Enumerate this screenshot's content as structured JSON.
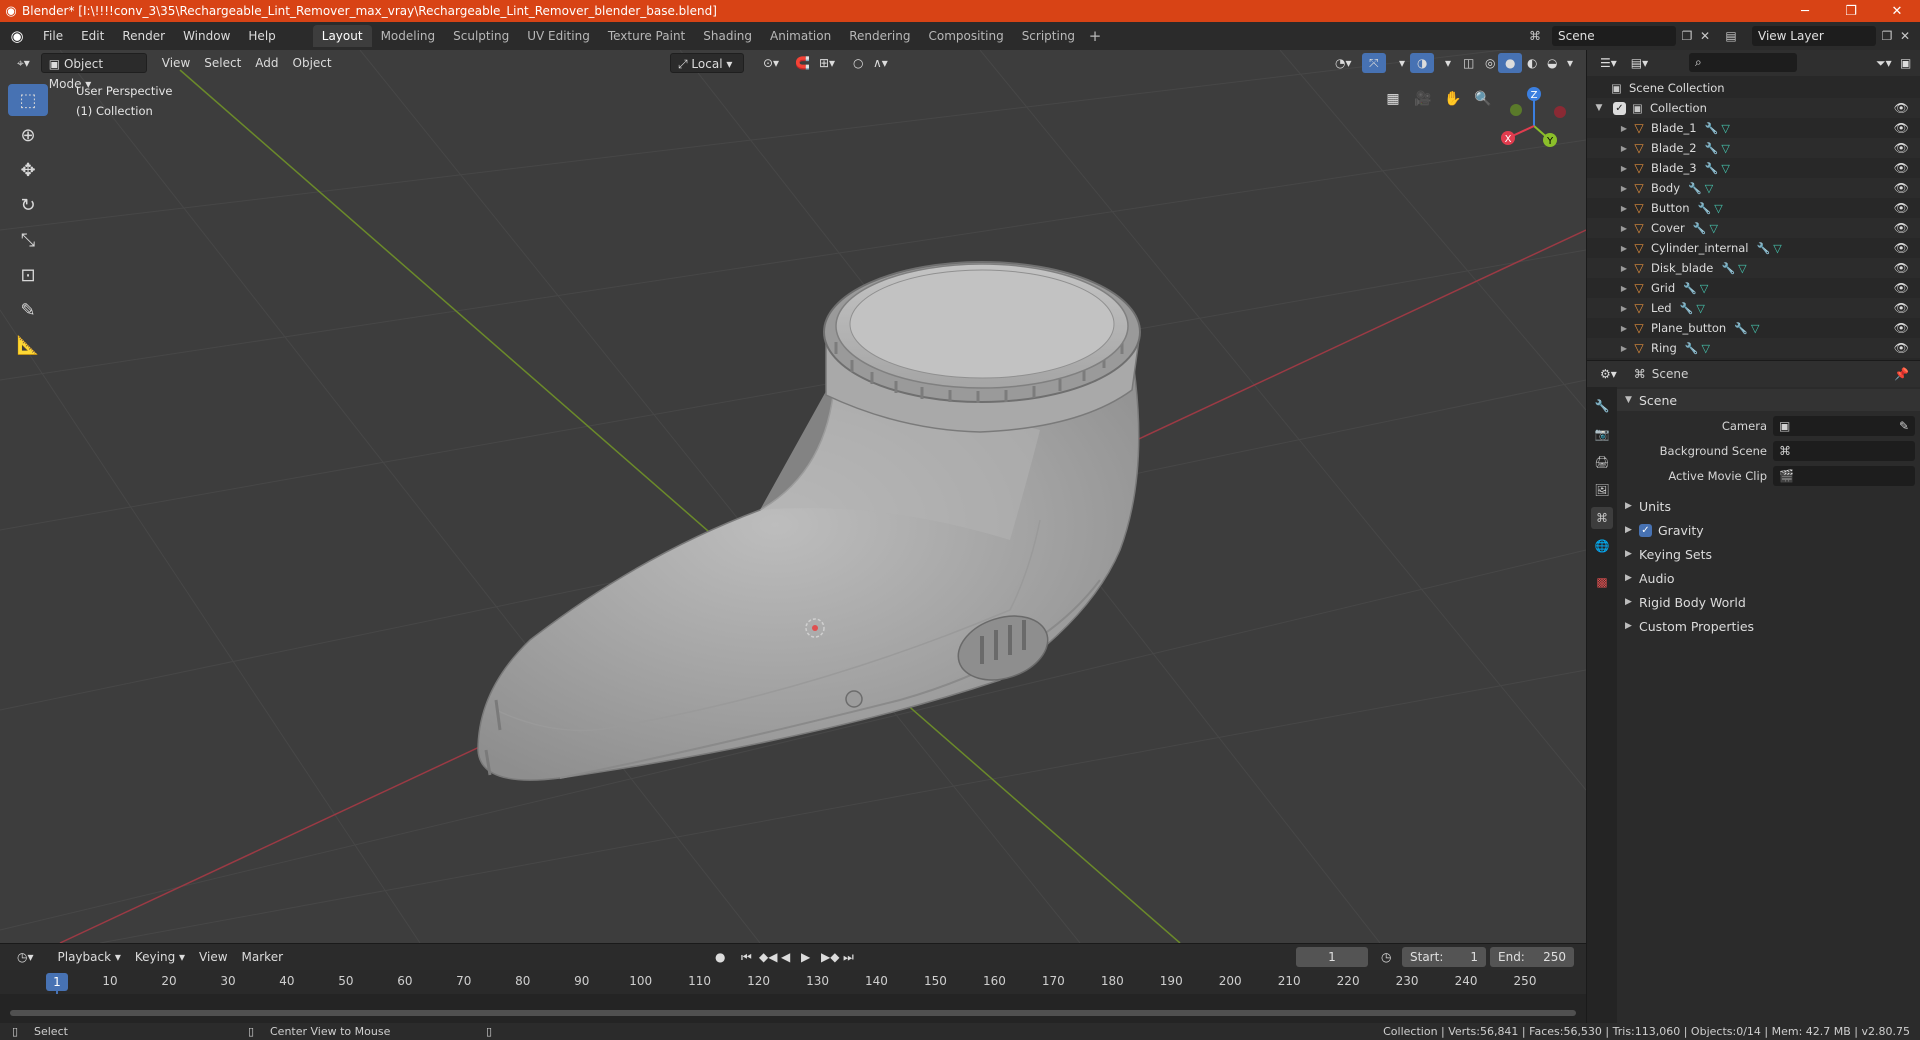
{
  "window": {
    "title": "Blender* [I:\\!!!!conv_3\\35\\Rechargeable_Lint_Remover_max_vray\\Rechargeable_Lint_Remover_blender_base.blend]",
    "minimize": "─",
    "maximize": "❐",
    "close": "✕"
  },
  "menu": [
    "File",
    "Edit",
    "Render",
    "Window",
    "Help"
  ],
  "workspaces": [
    "Layout",
    "Modeling",
    "Sculpting",
    "UV Editing",
    "Texture Paint",
    "Shading",
    "Animation",
    "Rendering",
    "Compositing",
    "Scripting"
  ],
  "active_workspace": "Layout",
  "scene_name": "Scene",
  "view_layer": "View Layer",
  "viewport": {
    "mode": "Object Mode",
    "menus": [
      "View",
      "Select",
      "Add",
      "Object"
    ],
    "transform_orientation": "Local",
    "perspective": "User Perspective",
    "collection": "(1) Collection",
    "gizmo_axes": {
      "x": "X",
      "y": "Y",
      "z": "Z"
    }
  },
  "tools": [
    "select-box",
    "cursor",
    "move",
    "rotate",
    "scale",
    "transform",
    "annotate",
    "measure"
  ],
  "timeline": {
    "menus": [
      "Playback",
      "Keying",
      "View",
      "Marker"
    ],
    "current_frame": "1",
    "start_label": "Start:",
    "start": "1",
    "end_label": "End:",
    "end": "250",
    "ticks": [
      1,
      10,
      20,
      30,
      40,
      50,
      60,
      70,
      80,
      90,
      100,
      110,
      120,
      130,
      140,
      150,
      160,
      170,
      180,
      190,
      200,
      210,
      220,
      230,
      240,
      250
    ]
  },
  "outliner": {
    "root": "Scene Collection",
    "collection": "Collection",
    "objects": [
      "Blade_1",
      "Blade_2",
      "Blade_3",
      "Body",
      "Button",
      "Cover",
      "Cylinder_internal",
      "Disk_blade",
      "Grid",
      "Led",
      "Plane_button",
      "Ring"
    ]
  },
  "properties": {
    "context": "Scene",
    "panel_title": "Scene",
    "fields": [
      {
        "label": "Camera",
        "value": ""
      },
      {
        "label": "Background Scene",
        "value": ""
      },
      {
        "label": "Active Movie Clip",
        "value": ""
      }
    ],
    "subpanels": [
      "Units",
      "Gravity",
      "Keying Sets",
      "Audio",
      "Rigid Body World",
      "Custom Properties"
    ],
    "gravity_checked": true
  },
  "statusbar": {
    "left": "Select",
    "middle": "Center View to Mouse",
    "stats": "Collection | Verts:56,841 | Faces:56,530 | Tris:113,060 | Objects:0/14 | Mem: 42.7 MB | v2.80.75"
  },
  "colors": {
    "accent": "#4772b3",
    "titlebar": "#d84315",
    "object_icon": "#e08d3c",
    "x_axis": "#e03c4e",
    "y_axis": "#8bbf2a",
    "z_axis": "#3b7fe0"
  }
}
